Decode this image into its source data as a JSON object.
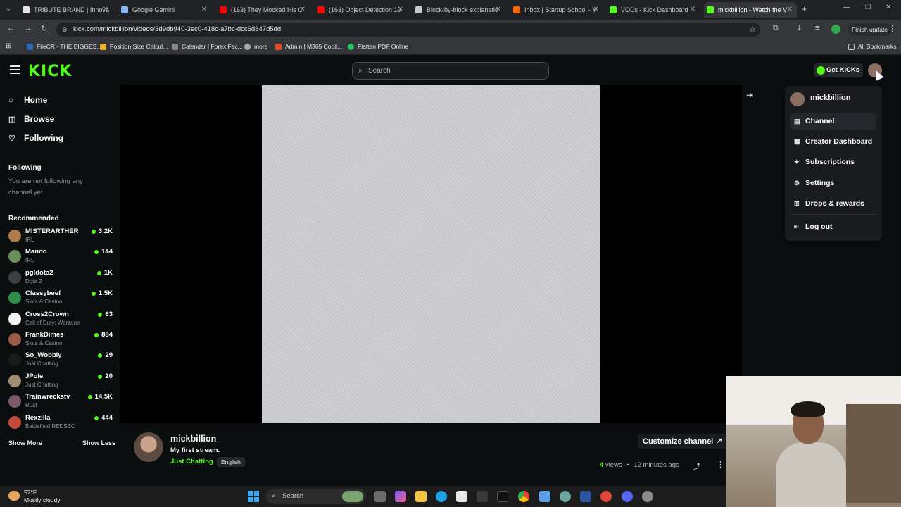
{
  "browser": {
    "tabs": [
      {
        "label": "TRIBUTE BRAND | Innova",
        "color": "#e5e5e5"
      },
      {
        "label": "Google Gemini",
        "color": "#8ab4f8"
      },
      {
        "label": "(163) They Mocked His C",
        "color": "#ff0000"
      },
      {
        "label": "(163) Object Detection 10",
        "color": "#ff0000"
      },
      {
        "label": "Block-by-block explanatio",
        "color": "#c8cacd"
      },
      {
        "label": "Inbox | Startup School - Y",
        "color": "#ff6600"
      },
      {
        "label": "VODs - Kick Dashboard",
        "color": "#53fc18"
      },
      {
        "label": "mickbillion - Watch the V",
        "color": "#53fc18"
      }
    ],
    "url": "kick.com/mickbillion/videos/3d9db940-3ec0-418c-a7bc-dcc6d847d5dd",
    "finish_update": "Finish update",
    "bookmarks": [
      {
        "label": "FileCR - THE BIGGES...",
        "color": "#2b6cb0"
      },
      {
        "label": "Position Size Calcul...",
        "color": "#f0b429"
      },
      {
        "label": "Calendar | Forex Fac...",
        "color": "#888888"
      },
      {
        "label": "more",
        "color": "#aaaaaa"
      },
      {
        "label": "Admin | M365 Copil...",
        "color": "#e34c26"
      },
      {
        "label": "Flatten PDF Online",
        "color": "#22c55e"
      }
    ],
    "all_bookmarks": "All Bookmarks"
  },
  "kick": {
    "logo": "KICK",
    "search_placeholder": "Search",
    "get_kicks": "Get KICKs"
  },
  "sidebar": {
    "nav": [
      {
        "label": "Home",
        "icon": "home-icon"
      },
      {
        "label": "Browse",
        "icon": "browse-icon"
      },
      {
        "label": "Following",
        "icon": "heart-icon"
      }
    ],
    "following_heading": "Following",
    "following_empty": "You are not following any channel yet.",
    "recommended_heading": "Recommended",
    "recommended": [
      {
        "name": "MISTERARTHER",
        "category": "IRL",
        "viewers": "3.2K",
        "color": "#b07a4a"
      },
      {
        "name": "Mando",
        "category": "IRL",
        "viewers": "144",
        "color": "#6b8e5a"
      },
      {
        "name": "pgldota2",
        "category": "Dota 2",
        "viewers": "1K",
        "color": "#3a3f44"
      },
      {
        "name": "Classybeef",
        "category": "Slots & Casino",
        "viewers": "1.5K",
        "color": "#2f8f4a"
      },
      {
        "name": "Cross2Crown",
        "category": "Call of Duty: Warzone",
        "viewers": "63",
        "color": "#f2f2f2"
      },
      {
        "name": "FrankDimes",
        "category": "Slots & Casino",
        "viewers": "884",
        "color": "#9a5b4a"
      },
      {
        "name": "So_Wobbly",
        "category": "Just Chatting",
        "viewers": "29",
        "color": "#1a1a1a"
      },
      {
        "name": "JPole",
        "category": "Just Chatting",
        "viewers": "20",
        "color": "#a08c70"
      },
      {
        "name": "Trainwreckstv",
        "category": "Rust",
        "viewers": "14.5K",
        "color": "#7a5a6a"
      },
      {
        "name": "Rexzilla",
        "category": "Battlefield REDSEC",
        "viewers": "444",
        "color": "#c44a3a"
      }
    ],
    "show_more": "Show More",
    "show_less": "Show Less"
  },
  "video": {
    "channel_name": "mickbillion",
    "title": "My first stream.",
    "category": "Just Chatting",
    "language": "English",
    "customize": "Customize channel",
    "views_count": "4",
    "views_label": "views",
    "separator": "•",
    "time_ago": "12 minutes ago"
  },
  "dropdown": {
    "username": "mickbillion",
    "items": [
      {
        "label": "Channel",
        "icon": "channel-icon",
        "glyph": "▤"
      },
      {
        "label": "Creator Dashboard",
        "icon": "dashboard-icon",
        "glyph": "▦"
      },
      {
        "label": "Subscriptions",
        "icon": "star-icon",
        "glyph": "✦"
      },
      {
        "label": "Settings",
        "icon": "gear-icon",
        "glyph": "⚙"
      },
      {
        "label": "Drops & rewards",
        "icon": "gift-icon",
        "glyph": "⊞"
      }
    ],
    "logout": "Log out"
  },
  "taskbar": {
    "temperature": "57°F",
    "weather": "Mostly cloudy",
    "search": "Search"
  },
  "colors": {
    "kick_green": "#53fc18",
    "background": "#0b0e0f",
    "panel": "#191b1f"
  }
}
